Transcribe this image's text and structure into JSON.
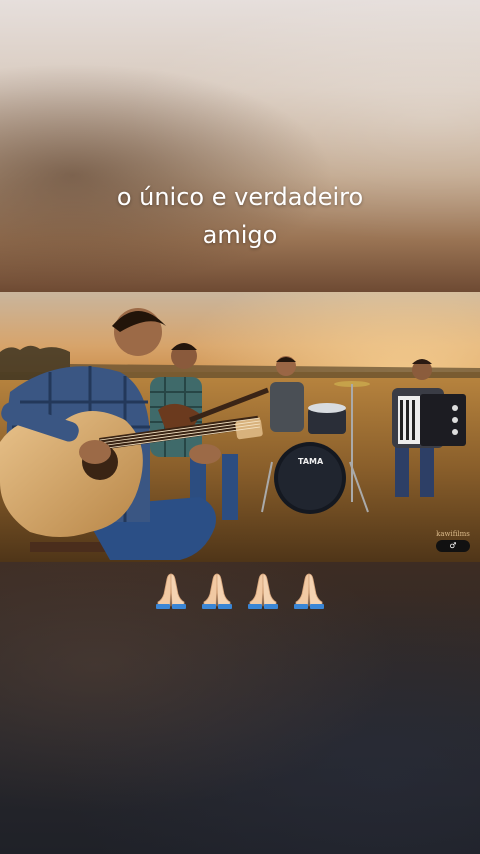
{
  "caption": {
    "line1": "o único e verdadeiro",
    "line2": "amigo"
  },
  "emoji_row": [
    "🙏",
    "🙏",
    "🙏",
    "🙏"
  ],
  "watermark": {
    "text": "kawifilms",
    "pill": "♂"
  },
  "photo": {
    "description_icon": "band-playing-in-field-photo"
  },
  "colors": {
    "caption_text": "#ffffff",
    "palm": "#f1c9a3",
    "cuff": "#3a86d6"
  }
}
